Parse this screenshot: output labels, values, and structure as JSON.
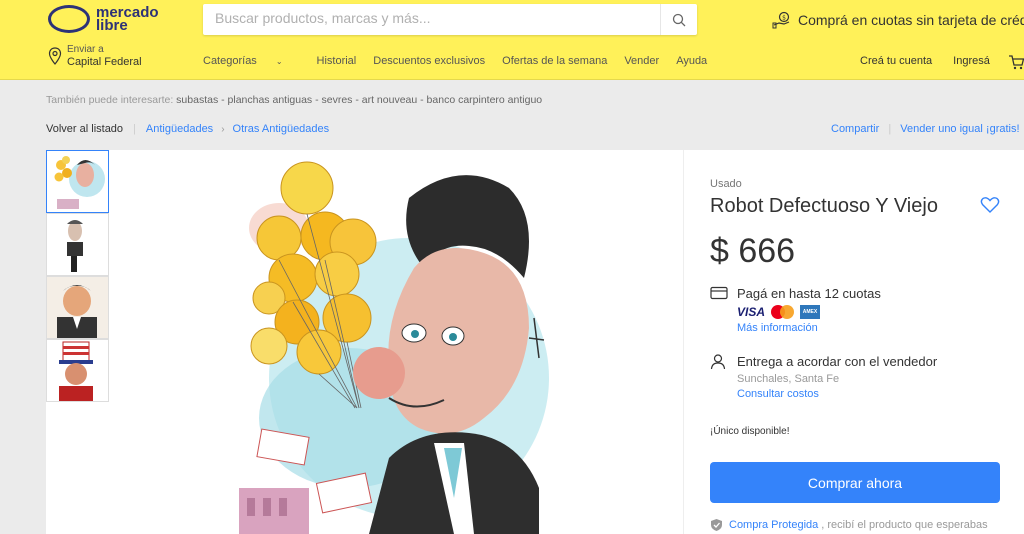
{
  "header": {
    "logo_line1": "mercado",
    "logo_line2": "libre",
    "search_placeholder": "Buscar productos, marcas y más...",
    "promo": "Comprá en cuotas sin tarjeta de crédito",
    "location_label": "Enviar a",
    "location_value": "Capital Federal",
    "nav": [
      "Categorías",
      "Historial",
      "Descuentos exclusivos",
      "Ofertas de la semana",
      "Vender",
      "Ayuda"
    ],
    "account": [
      "Creá tu cuenta",
      "Ingresá"
    ]
  },
  "related": {
    "label": "También puede interesarte:",
    "links": "subastas - planchas antiguas - sevres - art nouveau - banco carpintero antiguo"
  },
  "breadcrumb": {
    "back": "Volver al listado",
    "items": [
      "Antigüedades",
      "Otras Antigüedades"
    ],
    "share": "Compartir",
    "sell_same": "Vender uno igual ¡gratis!"
  },
  "product": {
    "condition": "Usado",
    "title": "Robot Defectuoso Y Viejo",
    "price": "$ 666",
    "installments": "Pagá en hasta 12 cuotas",
    "cards": [
      "VISA",
      "mastercard",
      "AMEX"
    ],
    "more_info": "Más información",
    "shipping": "Entrega a acordar con el vendedor",
    "seller_location": "Sunchales, Santa Fe",
    "shipping_costs": "Consultar costos",
    "stock": "¡Único disponible!",
    "buy_button": "Comprar ahora",
    "protect_link": "Compra Protegida",
    "protect_text": ", recibí el producto que esperabas"
  },
  "colors": {
    "header_bg": "#fff159",
    "brand_blue": "#3483fa",
    "logo_navy": "#2d3277"
  }
}
